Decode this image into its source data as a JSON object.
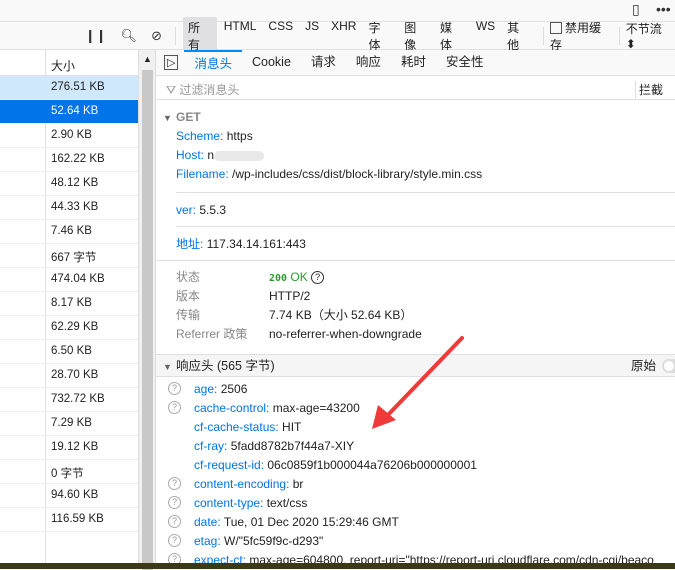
{
  "topbar": {
    "icons": [
      "responsive-icon",
      "more-icon"
    ]
  },
  "toolbar": {
    "filters": [
      "所有",
      "HTML",
      "CSS",
      "JS",
      "XHR",
      "字体",
      "图像",
      "媒体",
      "WS",
      "其他"
    ],
    "disable_cache": "禁用缓存",
    "throttle": "不节流 ⬍"
  },
  "list": {
    "header": "大小",
    "sizes": [
      "276.51 KB",
      "52.64 KB",
      "2.90 KB",
      "162.22 KB",
      "48.12 KB",
      "44.33 KB",
      "7.46 KB",
      "667 字节",
      "474.04 KB",
      "8.17 KB",
      "62.29 KB",
      "6.50 KB",
      "28.70 KB",
      "732.72 KB",
      "7.29 KB",
      "19.12 KB",
      "0 字节",
      "94.60 KB",
      "116.59 KB"
    ]
  },
  "tabs": [
    "消息头",
    "Cookie",
    "请求",
    "响应",
    "耗时",
    "安全性"
  ],
  "filter": {
    "placeholder": "过滤消息头",
    "block": "拦截"
  },
  "request": {
    "method": "GET",
    "scheme_k": "Scheme:",
    "scheme_v": "https",
    "host_k": "Host:",
    "host_v": "n",
    "filename_k": "Filename:",
    "filename_v": "/wp-includes/css/dist/block-library/style.min.css",
    "ver_k": "ver:",
    "ver_v": "5.5.3",
    "addr_k": "地址:",
    "addr_v": "117.34.14.161:443"
  },
  "status": {
    "status_k": "状态",
    "code": "200",
    "ok": "OK",
    "version_k": "版本",
    "version_v": "HTTP/2",
    "transfer_k": "传输",
    "transfer_v": "7.74 KB（大小 52.64 KB）",
    "referrer_k": "Referrer 政策",
    "referrer_v": "no-referrer-when-downgrade"
  },
  "response": {
    "title": "响应头 (565 字节)",
    "raw": "原始",
    "headers": [
      {
        "k": "age:",
        "v": "2506",
        "help": true
      },
      {
        "k": "cache-control:",
        "v": "max-age=43200",
        "help": true
      },
      {
        "k": "cf-cache-status:",
        "v": "HIT",
        "help": false
      },
      {
        "k": "cf-ray:",
        "v": "5fadd8782b7f44a7-XIY",
        "help": false
      },
      {
        "k": "cf-request-id:",
        "v": "06c0859f1b000044a76206b000000001",
        "help": false
      },
      {
        "k": "content-encoding:",
        "v": "br",
        "help": true
      },
      {
        "k": "content-type:",
        "v": "text/css",
        "help": true
      },
      {
        "k": "date:",
        "v": "Tue, 01 Dec 2020 15:29:46 GMT",
        "help": true
      },
      {
        "k": "etag:",
        "v": "W/\"5fc59f9c-d293\"",
        "help": true
      },
      {
        "k": "expect-ct:",
        "v": "max-age=604800, report-uri=\"https://report-uri.cloudflare.com/cdn-cgi/beaco",
        "help": true
      }
    ]
  },
  "colors": {
    "accent": "#0074e8",
    "ok": "#2a9b2a",
    "arrow": "#f03a3a"
  }
}
